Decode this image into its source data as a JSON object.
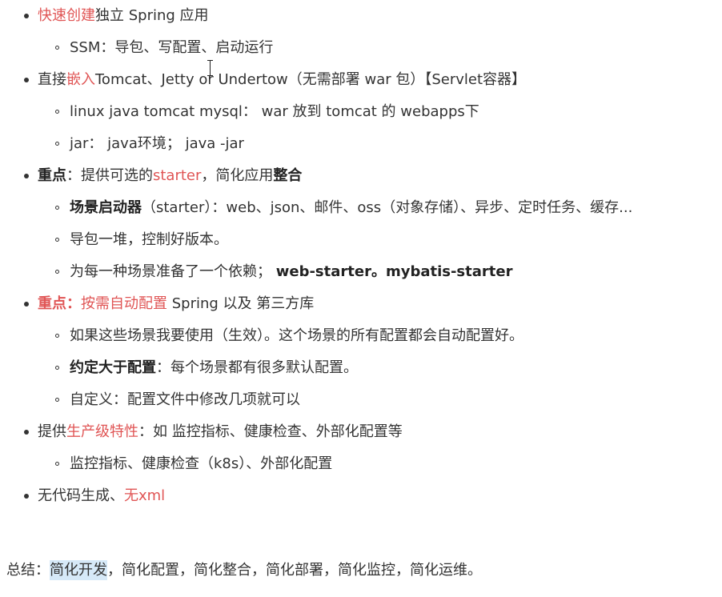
{
  "items": [
    {
      "parts": [
        {
          "text": "快速创建",
          "style": "red"
        },
        {
          "text": "独立 Spring 应用",
          "style": ""
        }
      ],
      "children": [
        {
          "parts": [
            {
              "text": "SSM：导包、写配置、启动运行",
              "style": ""
            }
          ]
        }
      ]
    },
    {
      "parts": [
        {
          "text": "直接",
          "style": ""
        },
        {
          "text": "嵌入",
          "style": "red"
        },
        {
          "text": "Tomcat、Jetty or Undertow（无需部署 war 包）【Servlet容器】",
          "style": ""
        }
      ],
      "children": [
        {
          "parts": [
            {
              "text": "linux  java tomcat mysql：  war 放到 tomcat 的 webapps下",
              "style": ""
            }
          ]
        },
        {
          "parts": [
            {
              "text": "jar：  java环境；   java -jar",
              "style": ""
            }
          ]
        }
      ]
    },
    {
      "parts": [
        {
          "text": "重点",
          "style": "bold"
        },
        {
          "text": "：提供可选的",
          "style": ""
        },
        {
          "text": "starter",
          "style": "red"
        },
        {
          "text": "，简化应用",
          "style": ""
        },
        {
          "text": "整合",
          "style": "bold"
        }
      ],
      "children": [
        {
          "parts": [
            {
              "text": "场景启动器",
              "style": "bold"
            },
            {
              "text": "（starter）：web、json、邮件、oss（对象存储）、异步、定时任务、缓存...",
              "style": ""
            }
          ]
        },
        {
          "parts": [
            {
              "text": "导包一堆，控制好版本。",
              "style": ""
            }
          ]
        },
        {
          "parts": [
            {
              "text": "为每一种场景准备了一个依赖；  ",
              "style": ""
            },
            {
              "text": "web-starter。mybatis-starter",
              "style": "bold"
            }
          ]
        }
      ]
    },
    {
      "parts": [
        {
          "text": "重点：",
          "style": "bold-red"
        },
        {
          "text": "按需自动配置",
          "style": "red"
        },
        {
          "text": " Spring 以及 第三方库",
          "style": ""
        }
      ],
      "children": [
        {
          "parts": [
            {
              "text": "如果这些场景我要使用（生效）。这个场景的所有配置都会自动配置好。",
              "style": ""
            }
          ]
        },
        {
          "parts": [
            {
              "text": "约定大于配置",
              "style": "bold"
            },
            {
              "text": "：每个场景都有很多默认配置。",
              "style": ""
            }
          ]
        },
        {
          "parts": [
            {
              "text": "自定义：配置文件中修改几项就可以",
              "style": ""
            }
          ]
        }
      ]
    },
    {
      "parts": [
        {
          "text": "提供",
          "style": ""
        },
        {
          "text": "生产级特性",
          "style": "red"
        },
        {
          "text": "：如 监控指标、健康检查、外部化配置等",
          "style": ""
        }
      ],
      "children": [
        {
          "parts": [
            {
              "text": "监控指标、健康检查（k8s）、外部化配置",
              "style": ""
            }
          ]
        }
      ]
    },
    {
      "parts": [
        {
          "text": "无代码生成、",
          "style": ""
        },
        {
          "text": "无xml",
          "style": "red"
        }
      ],
      "children": []
    }
  ],
  "summary": {
    "label": "总结：",
    "highlight": "简化开发",
    "rest": "，简化配置，简化整合，简化部署，简化监控，简化运维。"
  },
  "colors": {
    "accent_red": "#e05555",
    "text": "#333333",
    "highlight_bg": "#d6e9f8"
  }
}
